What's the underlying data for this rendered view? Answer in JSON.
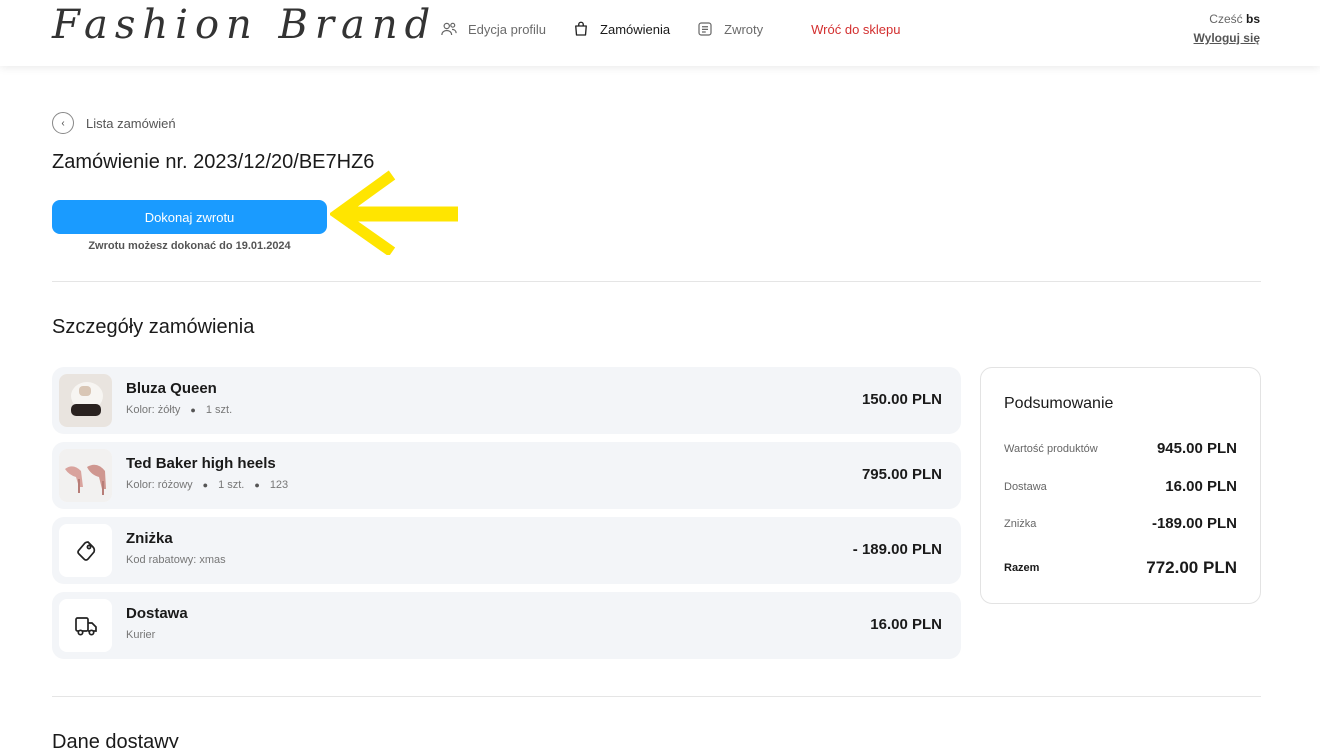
{
  "header": {
    "logo_text": "Fashion Brand",
    "nav": [
      {
        "label": "Edycja profilu",
        "icon": "users-icon",
        "active": false
      },
      {
        "label": "Zamówienia",
        "icon": "shopping-bag-icon",
        "active": true
      },
      {
        "label": "Zwroty",
        "icon": "document-icon",
        "active": false
      }
    ],
    "back_to_shop": "Wróć do sklepu",
    "greeting_prefix": "Cześć",
    "username": "bs",
    "logout": "Wyloguj się"
  },
  "back_link": "Lista zamówień",
  "order_title": "Zamówienie nr. 2023/12/20/BE7HZ6",
  "return_button": "Dokonaj zwrotu",
  "return_note": "Zwrotu możesz dokonać do 19.01.2024",
  "details_title": "Szczegóły zamówienia",
  "items": [
    {
      "name": "Bluza Queen",
      "meta": [
        "Kolor: żółty",
        "1 szt."
      ],
      "price": "150.00 PLN",
      "thumb": "product-image"
    },
    {
      "name": "Ted Baker high heels",
      "meta": [
        "Kolor: różowy",
        "1 szt.",
        "123"
      ],
      "price": "795.00 PLN",
      "thumb": "product-image"
    },
    {
      "name": "Zniżka",
      "meta": [
        "Kod rabatowy: xmas"
      ],
      "price": "- 189.00 PLN",
      "thumb": "tag-icon"
    },
    {
      "name": "Dostawa",
      "meta": [
        "Kurier"
      ],
      "price": "16.00 PLN",
      "thumb": "truck-icon"
    }
  ],
  "summary": {
    "title": "Podsumowanie",
    "rows": [
      {
        "label": "Wartość produktów",
        "value": "945.00 PLN"
      },
      {
        "label": "Dostawa",
        "value": "16.00 PLN"
      },
      {
        "label": "Zniżka",
        "value": "-189.00 PLN"
      }
    ],
    "total_label": "Razem",
    "total_value": "772.00 PLN"
  },
  "delivery_title": "Dane dostawy",
  "colors": {
    "accent": "#1a9bff",
    "back_to_shop": "#d32f2f",
    "arrow": "#ffe500",
    "card_bg": "#f3f5f8"
  }
}
